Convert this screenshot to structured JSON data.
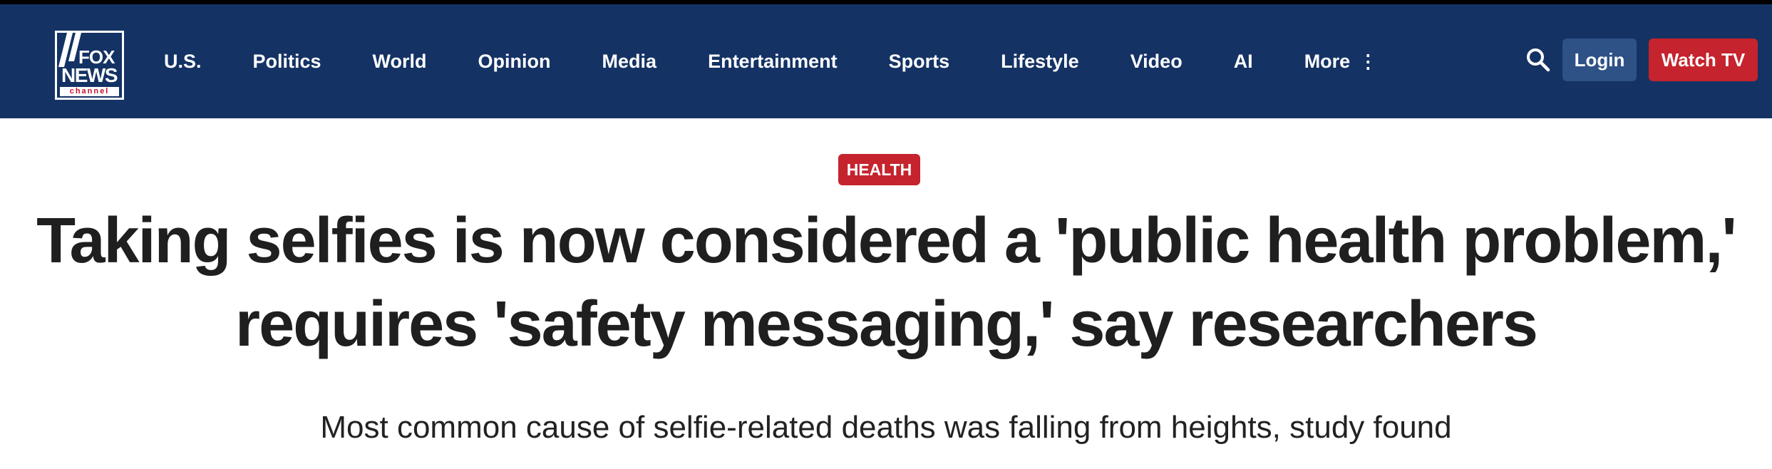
{
  "logo": {
    "fox": "FOX",
    "news": "NEWS",
    "channel": "channel"
  },
  "nav": {
    "items": [
      {
        "label": "U.S."
      },
      {
        "label": "Politics"
      },
      {
        "label": "World"
      },
      {
        "label": "Opinion"
      },
      {
        "label": "Media"
      },
      {
        "label": "Entertainment"
      },
      {
        "label": "Sports"
      },
      {
        "label": "Lifestyle"
      },
      {
        "label": "Video"
      },
      {
        "label": "AI"
      },
      {
        "label": "More",
        "icon": "kebab-vertical-icon"
      }
    ]
  },
  "header_actions": {
    "search_icon": "search-icon",
    "login_label": "Login",
    "watch_label": "Watch TV"
  },
  "article": {
    "category": "HEALTH",
    "headline_line1": "Taking selfies is now considered a 'public health problem,'",
    "headline_line2": "requires 'safety messaging,' say researchers",
    "subhead": "Most common cause of selfie-related deaths was falling from heights, study found"
  },
  "colors": {
    "header_bg": "#143264",
    "accent_red": "#c5232d",
    "login_bg": "#2e5186",
    "text_dark": "#1f1f1f"
  }
}
